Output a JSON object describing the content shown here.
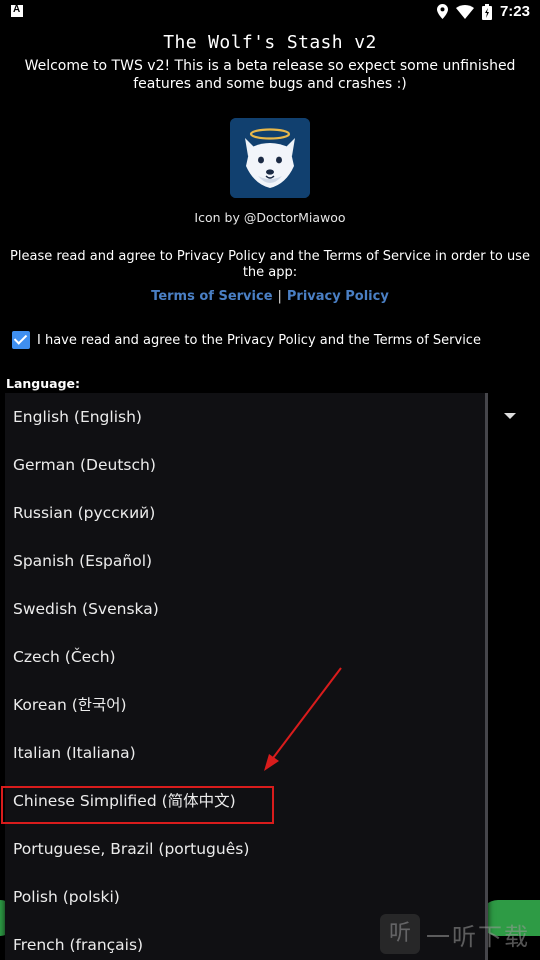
{
  "status_bar": {
    "time": "7:23",
    "icons": [
      "app-notification-icon",
      "location-icon",
      "wifi-icon",
      "battery-icon"
    ]
  },
  "app": {
    "title": "The Wolf's Stash v2",
    "welcome": "Welcome to TWS v2! This is a beta release so expect some unfinished features and some bugs and crashes :)",
    "icon_credit": "Icon by @DoctorMiawoo",
    "agree_prompt": "Please read and agree to Privacy Policy and the Terms of Service in order to use the app:",
    "terms_link": "Terms of Service",
    "link_separator": "|",
    "privacy_link": "Privacy Policy",
    "checkbox_label": "I have read and agree to the Privacy Policy and the Terms of Service",
    "checkbox_checked": true,
    "language_label": "Language:"
  },
  "language_menu": {
    "items": [
      "English (English)",
      "German (Deutsch)",
      "Russian (русский)",
      "Spanish (Español)",
      "Swedish (Svenska)",
      "Czech (Čech)",
      "Korean (한국어)",
      "Italian (Italiana)",
      "Chinese Simplified (简体中文)",
      "Portuguese, Brazil (português)",
      "Polish (polski)",
      "French (français)"
    ],
    "highlighted": "Chinese Simplified (简体中文)"
  },
  "watermark": {
    "logo_char": "听",
    "text": "一听下载"
  },
  "colors": {
    "background": "#000000",
    "link": "#4a7fc4",
    "checkbox": "#3f8ff0",
    "annotation": "#d91c1c",
    "green_button": "#2e9b45"
  }
}
